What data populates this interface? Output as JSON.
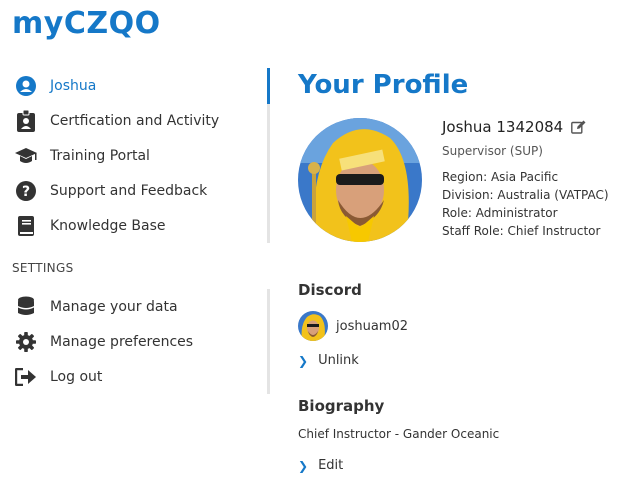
{
  "brand": "myCZQO",
  "sidebar": {
    "items": [
      {
        "label": "Joshua",
        "icon": "user-circle-icon"
      },
      {
        "label": "Certfication and Activity",
        "icon": "id-badge-icon"
      },
      {
        "label": "Training Portal",
        "icon": "graduation-cap-icon"
      },
      {
        "label": "Support and Feedback",
        "icon": "question-circle-icon"
      },
      {
        "label": "Knowledge Base",
        "icon": "book-icon"
      }
    ],
    "settings_label": "SETTINGS",
    "settings_items": [
      {
        "label": "Manage your data",
        "icon": "database-icon"
      },
      {
        "label": "Manage preferences",
        "icon": "cog-icon"
      },
      {
        "label": "Log out",
        "icon": "sign-out-icon"
      }
    ]
  },
  "main": {
    "title": "Your Profile",
    "profile": {
      "name": "Joshua 1342084",
      "rank": "Supervisor (SUP)",
      "region": "Region: Asia Pacific",
      "division": "Division: Australia (VATPAC)",
      "role": "Role: Administrator",
      "staff_role": "Staff Role: Chief Instructor"
    },
    "discord": {
      "heading": "Discord",
      "username": "joshuam02",
      "unlink_label": "Unlink"
    },
    "biography": {
      "heading": "Biography",
      "text": "Chief Instructor - Gander Oceanic",
      "edit_label": "Edit"
    }
  },
  "colors": {
    "accent": "#1578c8",
    "text": "#333333",
    "divider": "#e4e4e4"
  }
}
